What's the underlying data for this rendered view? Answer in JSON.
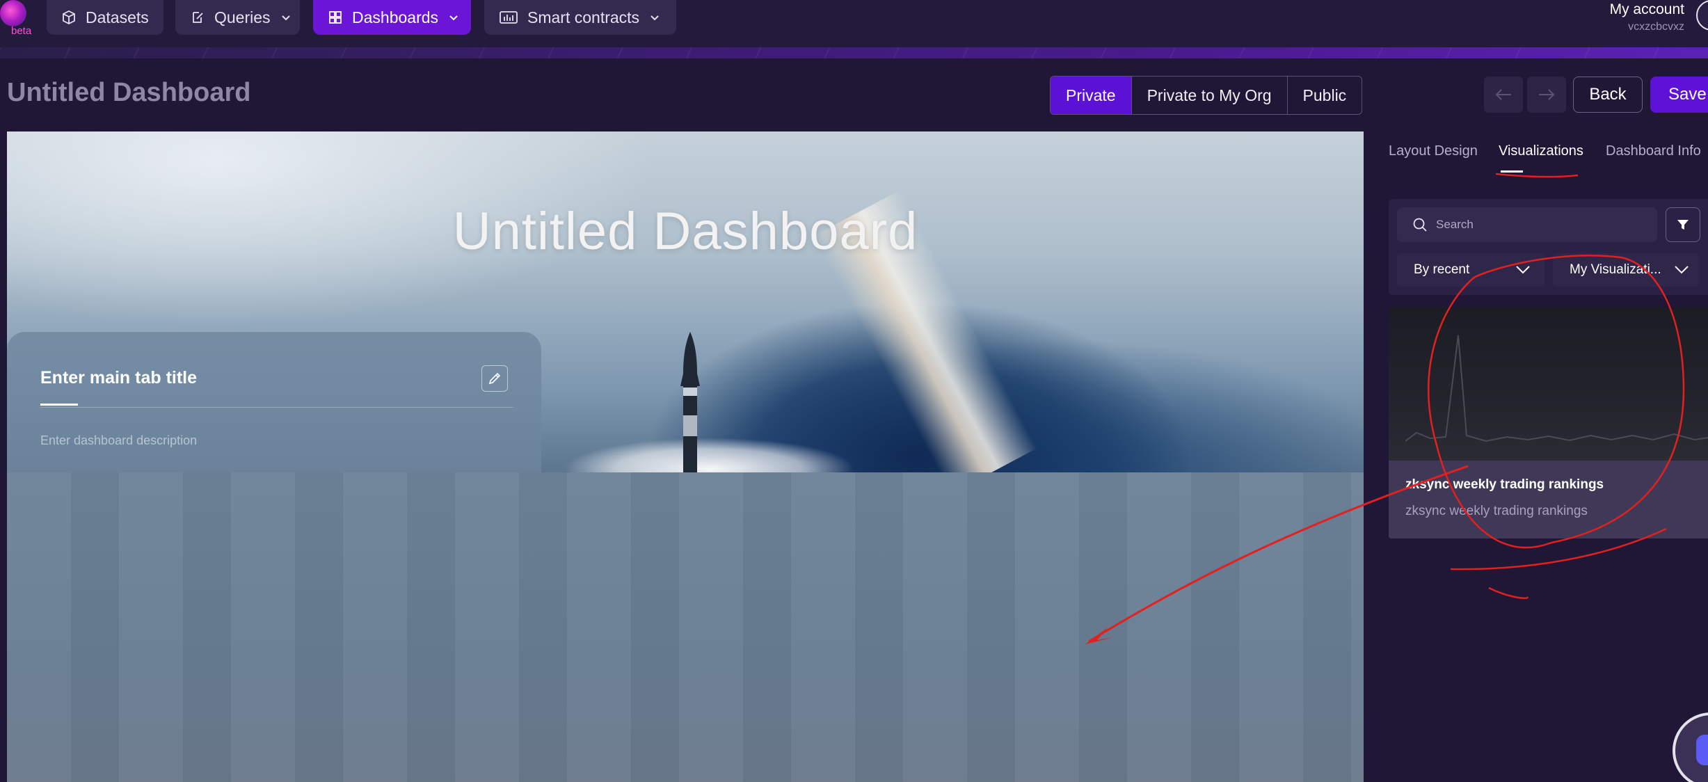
{
  "nav": {
    "logo_badge": "beta",
    "datasets": "Datasets",
    "queries": "Queries",
    "dashboards": "Dashboards",
    "smart_contracts": "Smart contracts",
    "account_label": "My account",
    "account_user": "vcxzcbcvxz"
  },
  "header": {
    "title": "Untitled Dashboard",
    "privacy_options": [
      "Private",
      "Private to My Org",
      "Public"
    ],
    "selected_privacy": "Private",
    "back_label": "Back",
    "save_label": "Save"
  },
  "canvas": {
    "hero_title": "Untitled Dashboard",
    "tab_title_placeholder": "Enter main tab title",
    "description_placeholder": "Enter dashboard description"
  },
  "panel": {
    "tabs": [
      "Layout Design",
      "Visualizations",
      "Dashboard Info"
    ],
    "active_tab": "Visualizations",
    "search_placeholder": "Search",
    "sort_label": "By recent",
    "scope_label": "My Visualizati...",
    "card": {
      "title": "zksync weekly trading rankings",
      "subtitle": "zksync weekly trading rankings"
    }
  },
  "colors": {
    "background": "#1f1735",
    "accent": "#5e12d6",
    "annotation": "#e32020"
  }
}
